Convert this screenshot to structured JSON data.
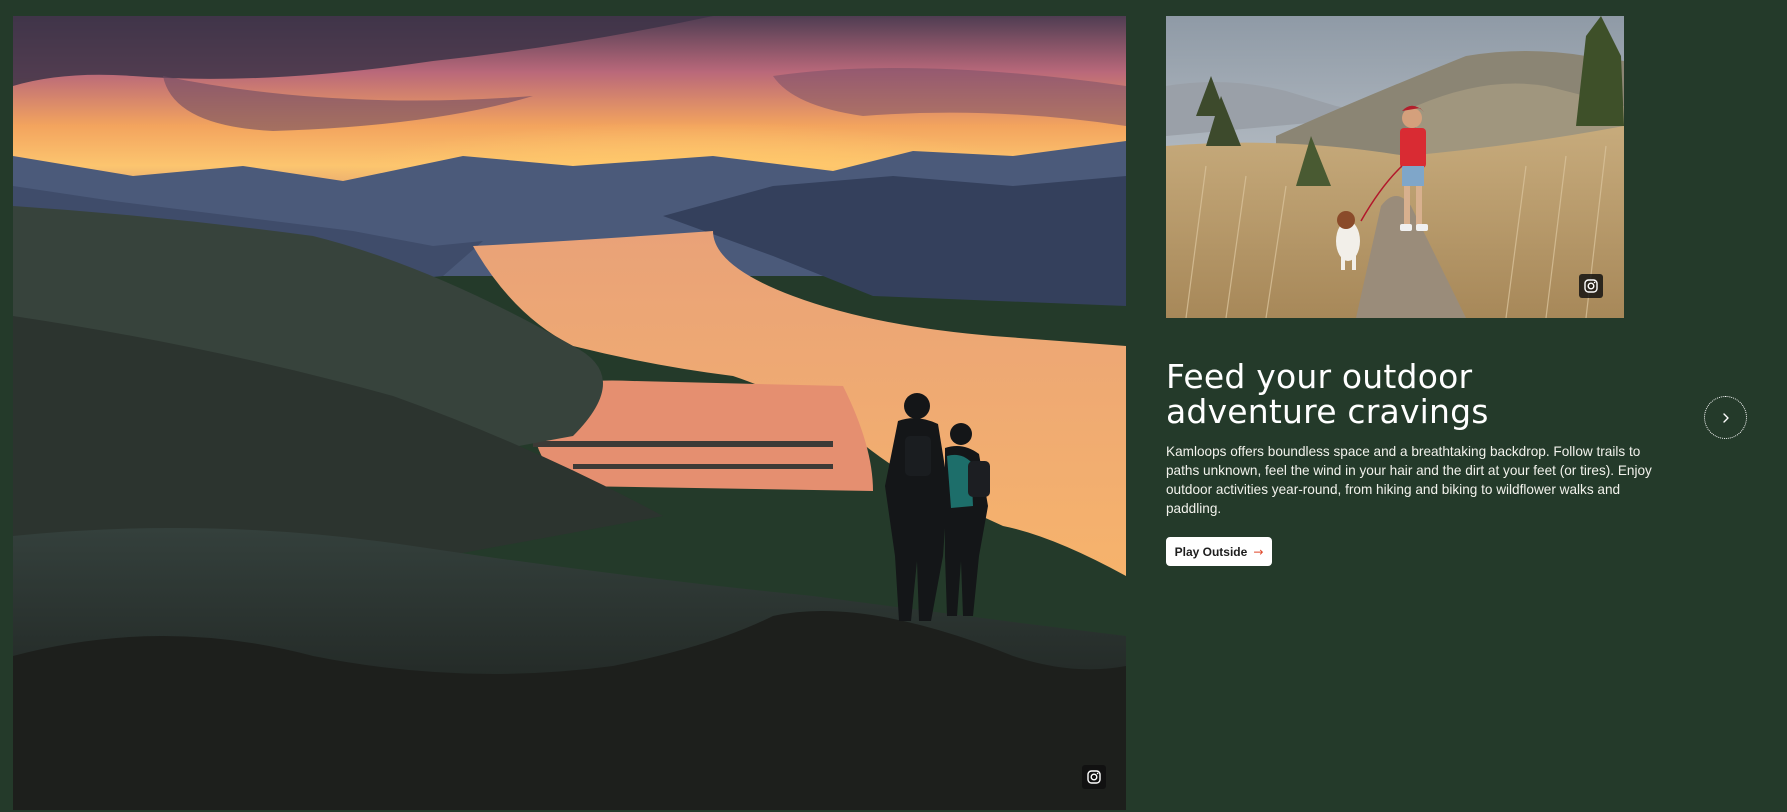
{
  "hero_image": {
    "icon": "instagram-icon"
  },
  "secondary_image": {
    "icon": "instagram-icon"
  },
  "feature": {
    "headline_line1": "Feed your outdoor",
    "headline_line2": "adventure cravings",
    "body": "Kamloops offers boundless space and a breathtaking backdrop. Follow trails to paths unknown, feel the wind in your hair and the dirt at your feet (or tires). Enjoy outdoor activities year-round, from hiking and biking to wildflower walks and paddling.",
    "cta_label": "Play Outside",
    "cta_icon": "arrow-right-icon"
  },
  "carousel": {
    "next_icon": "chevron-right-icon"
  },
  "colors": {
    "background": "#243a2a",
    "accent": "#e0482b",
    "button_bg": "#ffffff",
    "text": "#ffffff"
  }
}
